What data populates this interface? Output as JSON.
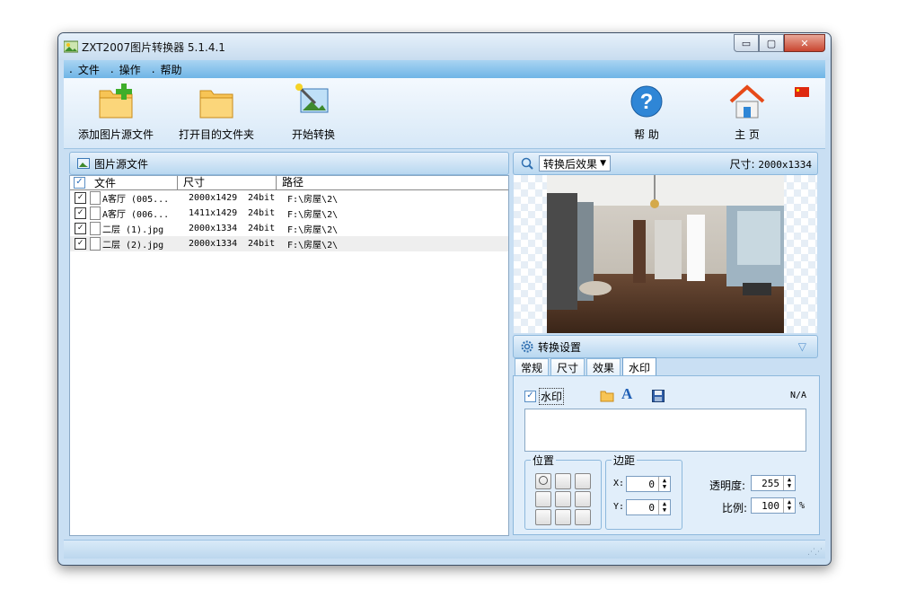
{
  "window": {
    "title": "ZXT2007图片转换器 5.1.4.1",
    "minimize": "▭",
    "maximize": "▢",
    "close": "✕"
  },
  "menu": [
    {
      "label": "文件"
    },
    {
      "label": "操作"
    },
    {
      "label": "帮助"
    }
  ],
  "toolbar": {
    "add_source": "添加图片源文件",
    "open_dest": "打开目的文件夹",
    "start": "开始转换",
    "help": "帮 助",
    "home": "主 页"
  },
  "source_panel": {
    "title": "图片源文件"
  },
  "file_list": {
    "headers": [
      "文件",
      "尺寸",
      "路径"
    ],
    "rows": [
      {
        "name": "A客厅 (005...",
        "size": "2000x1429",
        "depth": "24bit",
        "path": "F:\\房屋\\2\\",
        "checked": true
      },
      {
        "name": "A客厅 (006...",
        "size": "1411x1429",
        "depth": "24bit",
        "path": "F:\\房屋\\2\\",
        "checked": true
      },
      {
        "name": "二层 (1).jpg",
        "size": "2000x1334",
        "depth": "24bit",
        "path": "F:\\房屋\\2\\",
        "checked": true
      },
      {
        "name": "二层 (2).jpg",
        "size": "2000x1334",
        "depth": "24bit",
        "path": "F:\\房屋\\2\\",
        "checked": true
      }
    ]
  },
  "preview": {
    "mode": "转换后效果",
    "size_label": "尺寸:",
    "size_value": "2000x1334"
  },
  "settings": {
    "title": "转换设置",
    "tabs": [
      "常规",
      "尺寸",
      "效果",
      "水印"
    ],
    "watermark_label": "水印",
    "watermark_checked": true,
    "na": "N/A",
    "position_title": "位置",
    "margin_title": "边距",
    "x_label": "X:",
    "x_value": "0",
    "y_label": "Y:",
    "y_value": "0",
    "opacity_label": "透明度:",
    "opacity_value": "255",
    "scale_label": "比例:",
    "scale_value": "100",
    "scale_unit": "%"
  },
  "colors": {
    "accent": "#6fb5e6",
    "panel": "#c9dff3"
  }
}
